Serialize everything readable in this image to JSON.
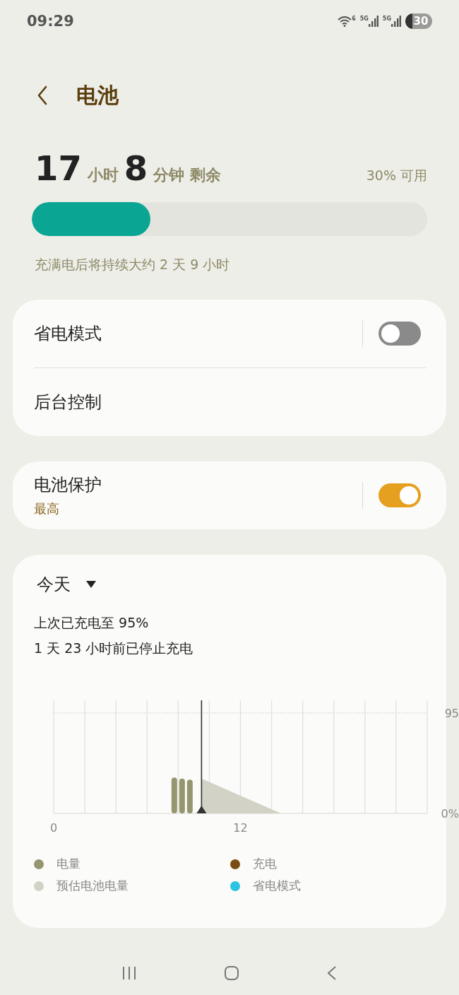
{
  "status_bar": {
    "time": "09:29",
    "wifi_label": "6",
    "sim_labels": [
      "5G",
      "5G"
    ],
    "battery": "30"
  },
  "header": {
    "title": "电池"
  },
  "summary": {
    "hours": "17",
    "hours_unit": "小时",
    "minutes": "8",
    "minutes_unit": "分钟",
    "remaining": "剩余",
    "available": "30% 可用",
    "level": 0.3,
    "full_charge_note": "充满电后将持续大约 2 天 9 小时"
  },
  "cards": [
    {
      "rows": [
        {
          "label": "省电模式",
          "kind": "toggle",
          "on": false
        },
        {
          "label": "后台控制",
          "kind": "link"
        }
      ]
    },
    {
      "rows": [
        {
          "label": "电池保护",
          "sub": "最高",
          "kind": "toggle",
          "on": true
        }
      ]
    }
  ],
  "usage": {
    "period": "今天",
    "last_charge": "上次已充电至 95%",
    "stopped": "1 天 23 小时前已停止充电",
    "chart_data": {
      "type": "bar",
      "x": [
        7.75,
        8.25,
        8.75
      ],
      "xlim": [
        0,
        24
      ],
      "ref_lines": [
        {
          "axis": "x",
          "value": 9.5
        }
      ],
      "ylim": [
        0,
        95
      ],
      "xticks": [
        0,
        12
      ],
      "yticks": [
        {
          "value": 95,
          "label": "95"
        },
        {
          "value": 0,
          "label": "0%"
        }
      ],
      "series": [
        {
          "name": "电量",
          "color": "#959670",
          "values": [
            34,
            33,
            32
          ]
        },
        {
          "name": "充电",
          "color": "#7a4e12",
          "values": [
            null,
            null,
            null
          ]
        },
        {
          "name": "预估电池电量",
          "color": "#d3d2c6",
          "values": [
            null,
            null,
            null
          ]
        },
        {
          "name": "省电模式",
          "color": "#2bc4e0",
          "values": [
            null,
            null,
            null
          ]
        }
      ]
    }
  }
}
